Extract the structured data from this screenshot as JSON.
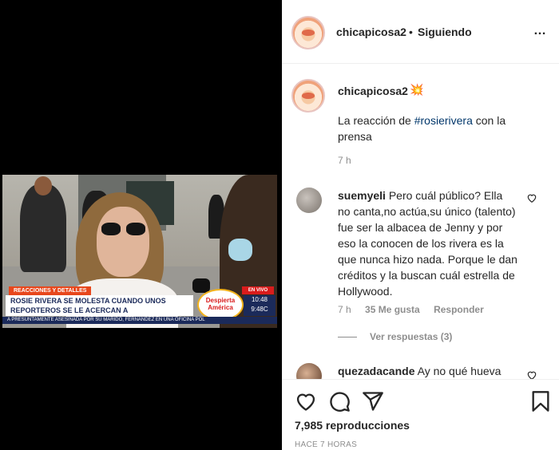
{
  "video": {
    "tag": "REACCIONES Y DETALLES",
    "headline": "ROSIE RIVERA SE MOLESTA CUANDO UNOS REPORTEROS SE LE ACERCAN A ENTREVISTARLA",
    "live": "EN VIVO",
    "logo": "Despierta América",
    "time1": "10:48",
    "time2": "9:48C",
    "ticker": "A PRESUNTAMENTE ASESINADA POR SU MARIDO, FERNANDEZ EN UNA OFICINA POL"
  },
  "header": {
    "username": "chicapicosa2",
    "dot": "•",
    "follow_label": "Siguiendo",
    "more_icon": "…"
  },
  "caption": {
    "username": "chicapicosa2",
    "emoji": "💥",
    "text_before": "La reacción de ",
    "hashtag": "#rosierivera",
    "text_after": " con la prensa",
    "time": "7 h"
  },
  "comment1": {
    "username": "suemyeli",
    "text": "Pero cuál público? Ella no canta,no actúa,su único (talento) fue ser la albacea de Jenny y por eso la conocen de los rivera es la que nunca hizo nada. Porque le dan créditos y la buscan cuál estrella de Hollywood.",
    "time": "7 h",
    "likes": "35 Me gusta",
    "reply_label": "Responder",
    "view_replies": "Ver respuestas (3)"
  },
  "comment2": {
    "username": "quezadacande",
    "text": "Ay no qué hueva"
  },
  "footer": {
    "views": "7,985 reproducciones",
    "ago": "HACE 7 HORAS"
  }
}
